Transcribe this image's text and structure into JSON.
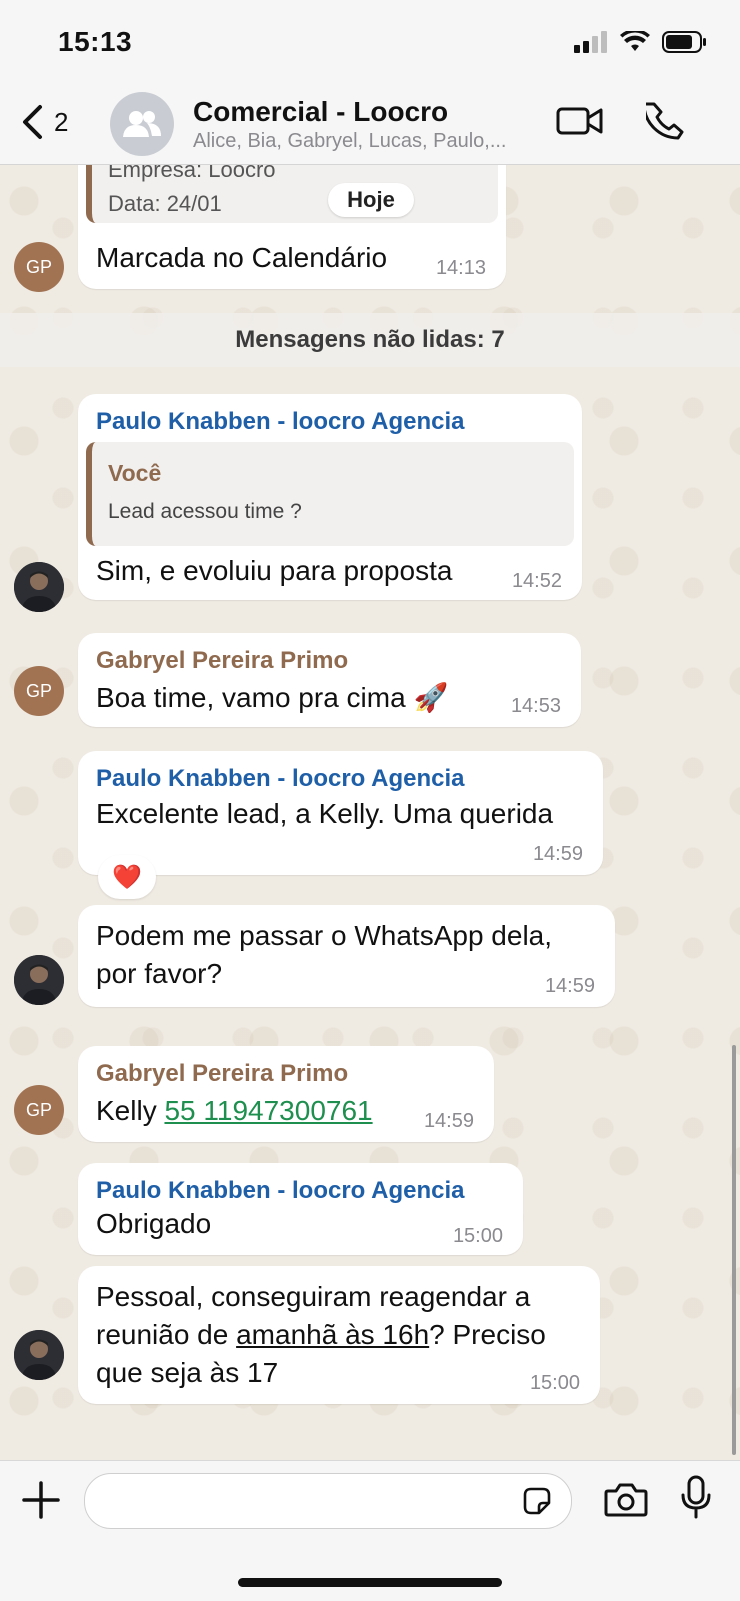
{
  "status": {
    "time": "15:13"
  },
  "header": {
    "back_count": "2",
    "title": "Comercial - Loocro",
    "subtitle": "Alice, Bia, Gabryel, Lucas, Paulo,..."
  },
  "chat": {
    "top_card": {
      "line_company": "Empresa: Loocro",
      "line_date": "Data: 24/01",
      "today_label": "Hoje",
      "message": "Marcada no Calendário",
      "time": "14:13",
      "avatar_initials": "GP"
    },
    "unread_label": "Mensagens não lidas: 7",
    "messages": [
      {
        "sender": "Paulo Knabben - loocro Agencia",
        "quote_author": "Você",
        "quote_text": "Lead acessou time ?",
        "text": "Sim, e evoluiu para proposta",
        "time": "14:52"
      },
      {
        "sender": "Gabryel Pereira Primo",
        "text": "Boa time, vamo pra cima 🚀",
        "time": "14:53",
        "avatar_initials": "GP"
      },
      {
        "sender": "Paulo Knabben - loocro Agencia",
        "text": "Excelente lead, a Kelly. Uma querida",
        "time": "14:59",
        "reaction": "❤️"
      },
      {
        "text_line1": "Podem me passar o WhatsApp dela,",
        "text_line2": "por favor?",
        "time": "14:59"
      },
      {
        "sender": "Gabryel Pereira Primo",
        "text_prefix": "Kelly ",
        "phone": "55 11947300761",
        "time": "14:59",
        "avatar_initials": "GP"
      },
      {
        "sender": "Paulo Knabben - loocro Agencia",
        "text": "Obrigado",
        "time": "15:00"
      },
      {
        "line1": "Pessoal, conseguiram reagendar a",
        "line2_prefix": "reunião de ",
        "line2_link": "amanhã às 16h",
        "line2_suffix": "? Preciso",
        "line3": "que seja às 17",
        "time": "15:00"
      }
    ]
  },
  "icons": {
    "back": "chevron-left-icon",
    "video": "video-camera-icon",
    "call": "phone-icon",
    "attach": "plus-icon",
    "sticker": "sticker-icon",
    "camera": "camera-icon",
    "mic": "microphone-icon"
  }
}
